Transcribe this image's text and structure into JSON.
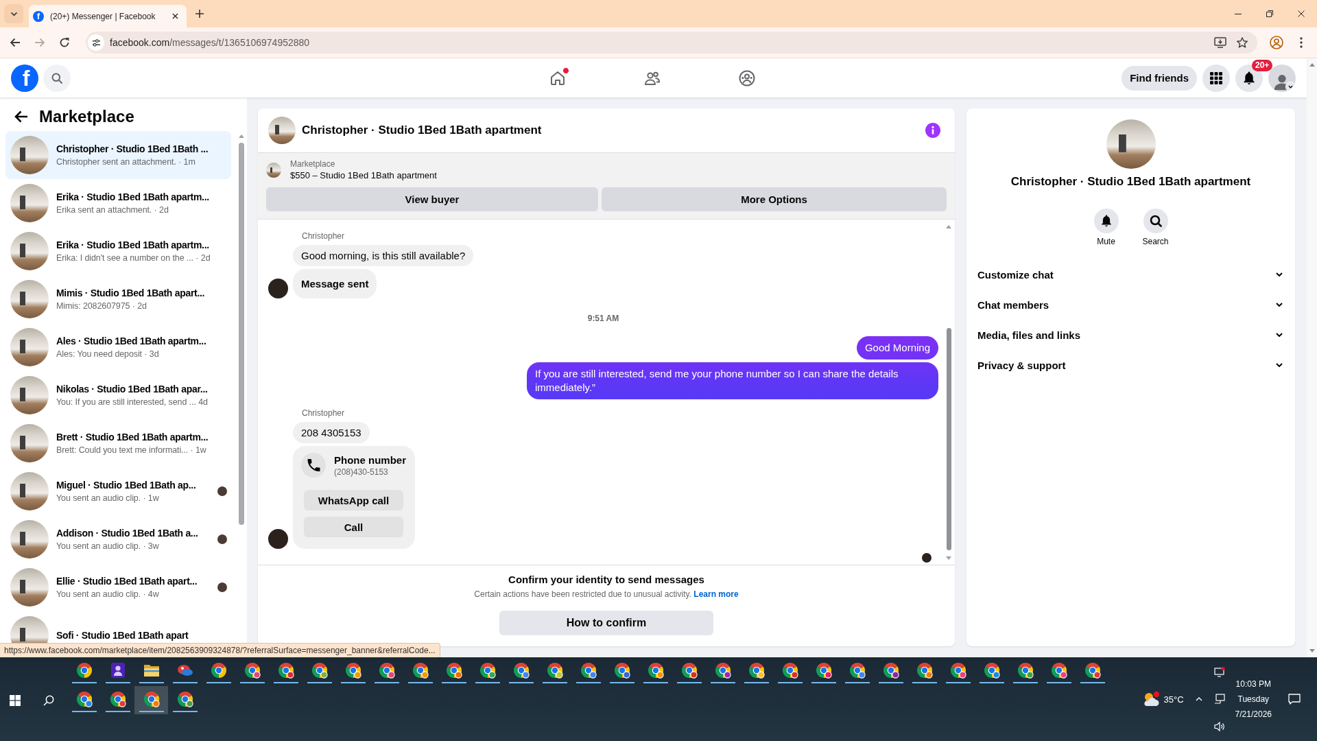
{
  "browser": {
    "tab": {
      "favicon": "f",
      "title": "(20+) Messenger | Facebook",
      "selected": true
    },
    "address": {
      "host": "facebook.com",
      "path": "/messages/t/1365106974952880"
    },
    "forward_disabled": true
  },
  "header": {
    "logo": "f",
    "nav": [
      {
        "kind": "home",
        "badge": true
      },
      {
        "kind": "friends",
        "badge": false
      },
      {
        "kind": "groups",
        "badge": false
      }
    ],
    "find_friends": "Find friends",
    "notification_count": "20+"
  },
  "sidebar": {
    "title": "Marketplace",
    "conversations": [
      {
        "title": "Christopher · Studio 1Bed 1Bath ...",
        "preview": "Christopher sent an attachment. · 1m",
        "selected": true,
        "seen": false
      },
      {
        "title": "Erika · Studio 1Bed 1Bath apartm...",
        "preview": "Erika sent an attachment. · 2d",
        "selected": false,
        "seen": false
      },
      {
        "title": "Erika · Studio 1Bed 1Bath apartm...",
        "preview": "Erika: I didn't see a number on the ... · 2d",
        "selected": false,
        "seen": false
      },
      {
        "title": "Mimis · Studio 1Bed 1Bath apart...",
        "preview": "Mimis: 2082607975 · 2d",
        "selected": false,
        "seen": false
      },
      {
        "title": "Ales · Studio 1Bed 1Bath apartm...",
        "preview": "Ales: You need deposit · 3d",
        "selected": false,
        "seen": false
      },
      {
        "title": "Nikolas · Studio 1Bed 1Bath apar...",
        "preview": "You: If you are still interested, send ... 4d",
        "selected": false,
        "seen": false
      },
      {
        "title": "Brett · Studio 1Bed 1Bath apartm...",
        "preview": "Brett: Could you text me informati... · 1w",
        "selected": false,
        "seen": false
      },
      {
        "title": "Miguel · Studio 1Bed 1Bath ap...",
        "preview": "You sent an audio clip. · 1w",
        "selected": false,
        "seen": true
      },
      {
        "title": "Addison · Studio 1Bed 1Bath a...",
        "preview": "You sent an audio clip. · 3w",
        "selected": false,
        "seen": true
      },
      {
        "title": "Ellie · Studio 1Bed 1Bath apart...",
        "preview": "You sent an audio clip. · 4w",
        "selected": false,
        "seen": true
      },
      {
        "title": "Sofi · Studio 1Bed 1Bath apart",
        "selected": false,
        "seen": false
      }
    ]
  },
  "chat": {
    "title": "Christopher · Studio 1Bed 1Bath apartment",
    "listing": {
      "source": "Marketplace",
      "title": "$550 – Studio 1Bed 1Bath apartment",
      "buttons": [
        "View buyer",
        "More Options"
      ]
    },
    "messages": [
      {
        "kind": "sender",
        "text": "Christopher"
      },
      {
        "kind": "incoming",
        "text": "Good morning, is this still available?",
        "avatar": false
      },
      {
        "kind": "notice",
        "text": "Message sent",
        "avatar": true
      },
      {
        "kind": "time",
        "text": "9:51 AM"
      },
      {
        "kind": "outgoing",
        "text": "Good Morning"
      },
      {
        "kind": "outgoing",
        "text": "If you are still interested, send me your phone number so I can share the details immediately.”"
      },
      {
        "kind": "sender",
        "text": "Christopher"
      },
      {
        "kind": "incoming",
        "text": "208 4305153",
        "avatar": false
      },
      {
        "kind": "contact",
        "title": "Phone number",
        "detail": "(208)430-5153",
        "buttons": [
          "WhatsApp call",
          "Call"
        ],
        "avatar": true
      }
    ],
    "read_receipt": true,
    "composer": {
      "title": "Confirm your identity to send messages",
      "text": "Certain actions have been restricted due to unusual activity.",
      "link": "Learn more",
      "button": "How to confirm"
    }
  },
  "details": {
    "title": "Christopher · Studio 1Bed 1Bath apartment",
    "actions": [
      {
        "kind": "mute",
        "label": "Mute"
      },
      {
        "kind": "search",
        "label": "Search"
      }
    ],
    "sections": [
      {
        "label": "Customize chat",
        "expanded": false
      },
      {
        "label": "Chat members",
        "expanded": false
      },
      {
        "label": "Media, files and links",
        "expanded": false
      },
      {
        "label": "Privacy & support",
        "expanded": false
      }
    ]
  },
  "status_url": "https://www.facebook.com/marketplace/item/2082563909324878/?referralSurface=messenger_banner&referralCode...",
  "taskbar": {
    "top_row": [
      {
        "kind": "browser",
        "running": true,
        "selected": false
      },
      {
        "kind": "tile",
        "running": true,
        "selected": false
      },
      {
        "kind": "folder",
        "running": true,
        "selected": false
      },
      {
        "kind": "swirl",
        "running": true,
        "selected": false
      },
      {
        "kind": "browser",
        "running": true,
        "selected": false
      },
      {
        "kind": "browser",
        "color": "#e8437a",
        "running": true,
        "selected": false
      },
      {
        "kind": "browser",
        "color": "#d93025",
        "running": true,
        "selected": false
      },
      {
        "kind": "browser",
        "color": "#7cb342",
        "running": true,
        "selected": false
      },
      {
        "kind": "browser",
        "color": "#f29900",
        "running": true,
        "selected": false
      },
      {
        "kind": "browser",
        "color": "#e8437a",
        "running": true,
        "selected": false
      },
      {
        "kind": "browser",
        "color": "#f29900",
        "running": true,
        "selected": false
      },
      {
        "kind": "browser",
        "color": "#ef6c00",
        "running": true,
        "selected": false
      },
      {
        "kind": "browser",
        "color": "#34a853",
        "running": true,
        "selected": false
      },
      {
        "kind": "browser",
        "color": "#4285f4",
        "running": true,
        "selected": false
      },
      {
        "kind": "browser",
        "color": "#c0ca33",
        "running": true,
        "selected": false
      },
      {
        "kind": "browser",
        "color": "#4285f4",
        "running": true,
        "selected": false
      },
      {
        "kind": "browser",
        "color": "#3367d6",
        "running": true,
        "selected": false
      },
      {
        "kind": "browser",
        "color": "#f29900",
        "running": true,
        "selected": false
      },
      {
        "kind": "browser",
        "color": "#d93025",
        "running": true,
        "selected": false
      },
      {
        "kind": "browser",
        "color": "#9c27b0",
        "running": true,
        "selected": false
      },
      {
        "kind": "browser",
        "color": "#fbc02d",
        "running": true,
        "selected": false
      },
      {
        "kind": "browser",
        "color": "#d93025",
        "running": true,
        "selected": false
      },
      {
        "kind": "browser",
        "color": "#e91e63",
        "running": true,
        "selected": false
      },
      {
        "kind": "browser",
        "color": "#4285f4",
        "running": true,
        "selected": false
      },
      {
        "kind": "browser",
        "color": "#8e24aa",
        "running": true,
        "selected": false
      },
      {
        "kind": "browser",
        "color": "#f57c00",
        "running": true,
        "selected": false
      },
      {
        "kind": "browser",
        "color": "#ec407a",
        "running": true,
        "selected": false
      },
      {
        "kind": "browser",
        "color": "#1e88e5",
        "running": true,
        "selected": false
      },
      {
        "kind": "browser",
        "color": "#43a047",
        "running": true,
        "selected": false
      },
      {
        "kind": "browser",
        "color": "#ec407a",
        "running": true,
        "selected": false
      },
      {
        "kind": "browser",
        "color": "#e53935",
        "running": true,
        "selected": false
      }
    ],
    "bottom_row": [
      {
        "kind": "browser",
        "color": "#1e88e5",
        "running": true,
        "selected": false
      },
      {
        "kind": "browser",
        "color": "#e53935",
        "running": true,
        "selected": false
      },
      {
        "kind": "browser",
        "color": "#f57c00",
        "running": true,
        "selected": true
      },
      {
        "kind": "browser",
        "color": "#43a047",
        "running": true,
        "selected": false
      }
    ],
    "tray": {
      "weather_alert": true,
      "temperature": "35°C",
      "time": "10:03 PM",
      "day": "Tuesday",
      "date": "7/21/2026"
    }
  }
}
